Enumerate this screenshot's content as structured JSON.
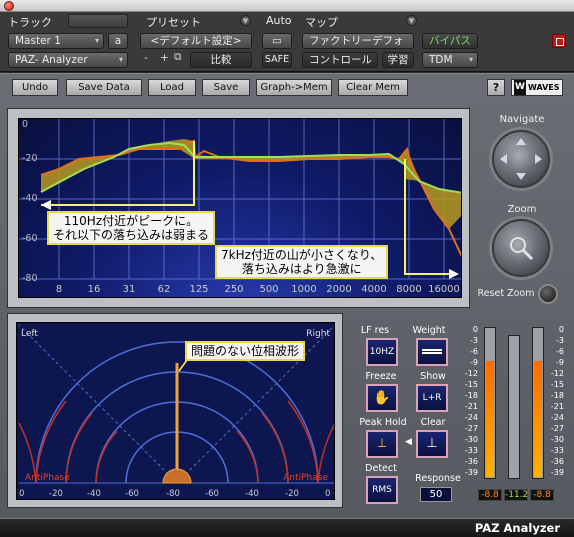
{
  "header": {
    "track_label": "トラック",
    "preset_label": "プリセット",
    "auto_label": "Auto",
    "map_label": "マップ",
    "track_name": "Master 1",
    "track_channel": "a",
    "plugin_name": "PAZ- Analyzer",
    "preset_default": "<デフォルト設定>",
    "minus": "-",
    "plus": "+",
    "compare": "比較",
    "safe": "SAFE",
    "factory_default": "ファクトリーデフォ",
    "bypass": "バイパス",
    "control": "コントロール",
    "learn": "学習",
    "tdm": "TDM"
  },
  "toolbar": {
    "buttons": [
      "Undo",
      "Save Data",
      "Load",
      "Save",
      "Graph->Mem",
      "Clear Mem"
    ],
    "help": "?",
    "brand": "WAVES"
  },
  "spectrum": {
    "y_ticks": [
      "0",
      "-20",
      "-40",
      "-60",
      "-80"
    ],
    "x_ticks": [
      "8",
      "16",
      "31",
      "62",
      "125",
      "250",
      "500",
      "1000",
      "2000",
      "4000",
      "8000",
      "16000"
    ],
    "annotation_low_line1": "110Hz付近がピークに。",
    "annotation_low_line2": "それ以下の落ち込みは弱まる",
    "annotation_high_line1": "7kHz付近の山が小さくなり、",
    "annotation_high_line2": "落ち込みはより急激に",
    "colors": {
      "memory_curve": "#e07020",
      "live_curve": "#9ee05a",
      "fill": "#b89a1e"
    }
  },
  "navigator": {
    "navigate_label": "Navigate",
    "zoom_label": "Zoom",
    "reset_label": "Reset Zoom"
  },
  "phase": {
    "left_label": "Left",
    "right_label": "Right",
    "antiphase_left": "AntiPhase",
    "antiphase_right": "AntiPhase",
    "annotation": "問題のない位相波形",
    "scale": [
      "0",
      "-20",
      "-40",
      "-60",
      "-80",
      "-60",
      "-40",
      "-20",
      "0"
    ]
  },
  "controls": {
    "lf_res_label": "LF res",
    "lf_res_value": "10HZ",
    "weight_label": "Weight",
    "freeze_label": "Freeze",
    "show_label": "Show",
    "show_value": "L+R",
    "peak_hold_label": "Peak Hold",
    "clear_label": "Clear",
    "detect_label": "Detect",
    "detect_value": "RMS",
    "response_label": "Response",
    "response_value": "50"
  },
  "meters": {
    "scale": [
      "0",
      "-3",
      "-6",
      "-9",
      "-12",
      "-15",
      "-18",
      "-21",
      "-24",
      "-27",
      "-30",
      "-33",
      "-36",
      "-39"
    ],
    "left_reading": "-8.8",
    "mid_reading": "-11.2",
    "right_reading": "-8.8",
    "left_level_db": -8.8,
    "right_level_db": -8.8
  },
  "footer": {
    "name": "PAZ Analyzer"
  }
}
